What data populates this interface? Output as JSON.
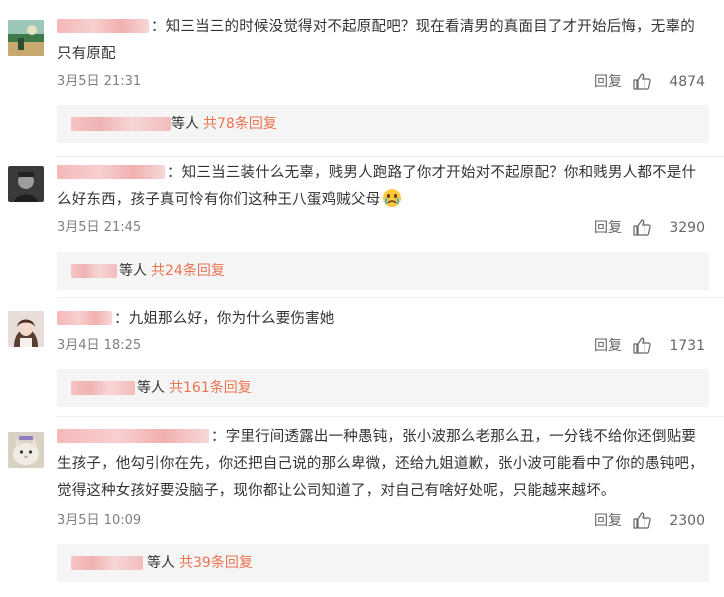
{
  "comments": [
    {
      "text": "知三当三的时候没觉得对不起原配吧？现在看清男的真面目了才开始后悔，无辜的只有原配",
      "time": "3月5日 21:31",
      "reply_label": "回复",
      "likes": "4874",
      "sub_suffix": "等人",
      "sub_more": "共78条回复"
    },
    {
      "text": "知三当三装什么无辜，贱男人跑路了你才开始对不起原配？你和贱男人都不是什么好东西，孩子真可怜有你们这种王八蛋鸡贼父母",
      "time": "3月5日 21:45",
      "reply_label": "回复",
      "likes": "3290",
      "sub_suffix": "等人",
      "sub_more": "共24条回复"
    },
    {
      "text": "九姐那么好，你为什么要伤害她",
      "time": "3月4日 18:25",
      "reply_label": "回复",
      "likes": "1731",
      "sub_suffix": "等人",
      "sub_more": "共161条回复"
    },
    {
      "text": "字里行间透露出一种愚钝，张小波那么老那么丑，一分钱不给你还倒贴要生孩子，他勾引你在先，你还把自己说的那么卑微，还给九姐道歉，张小波可能看中了你的愚钝吧，觉得这种女孩好要没脑子，现你都让公司知道了，对自己有啥好处呢，只能越来越坏。",
      "time": "3月5日 10:09",
      "reply_label": "回复",
      "likes": "2300",
      "sub_suffix": "等人",
      "sub_more": "共39条回复"
    }
  ],
  "colors": {
    "link": "#eb7350",
    "meta": "#808080",
    "subbox_bg": "#f5f5f5"
  }
}
